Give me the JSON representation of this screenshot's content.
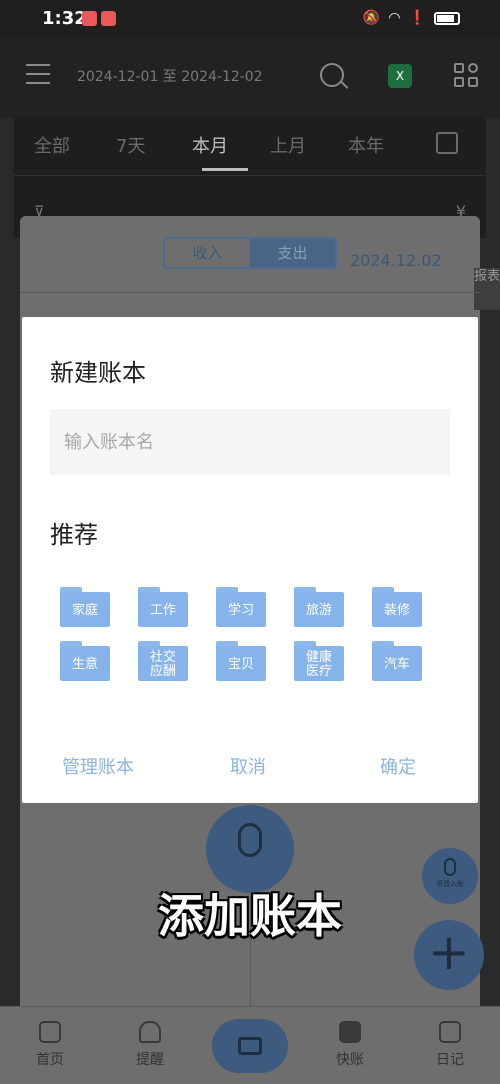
{
  "status": {
    "time": "1:32"
  },
  "header": {
    "date_range": "2024-12-01 至 2024-12-02",
    "excel_label": "X"
  },
  "tabs": [
    {
      "label": "全部"
    },
    {
      "label": "7天"
    },
    {
      "label": "本月"
    },
    {
      "label": "上月"
    },
    {
      "label": "本年"
    }
  ],
  "filter": {
    "filter_symbol": "⊽",
    "currency_symbol": "¥"
  },
  "behind": {
    "segment": {
      "income": "收入",
      "expense": "支出"
    },
    "date": "2024.12.02",
    "side_label": "报表"
  },
  "dialog": {
    "title": "新建账本",
    "input_placeholder": "输入账本名",
    "recommend_title": "推荐",
    "folders": [
      {
        "label": "家庭"
      },
      {
        "label": "工作"
      },
      {
        "label": "学习"
      },
      {
        "label": "旅游"
      },
      {
        "label": "装修"
      },
      {
        "label": "生意"
      },
      {
        "label": "社交应酬"
      },
      {
        "label": "宝贝"
      },
      {
        "label": "健康医疗"
      },
      {
        "label": "汽车"
      }
    ],
    "actions": {
      "manage": "管理账本",
      "cancel": "取消",
      "confirm": "确定"
    }
  },
  "voice_small_label": "语音入账",
  "caption": "添加账本",
  "bottom_nav": {
    "home": "首页",
    "remind": "提醒",
    "quick": "快账",
    "diary": "日记"
  },
  "colors": {
    "accent": "#86b4ea",
    "action_text": "#8bb4dc"
  }
}
